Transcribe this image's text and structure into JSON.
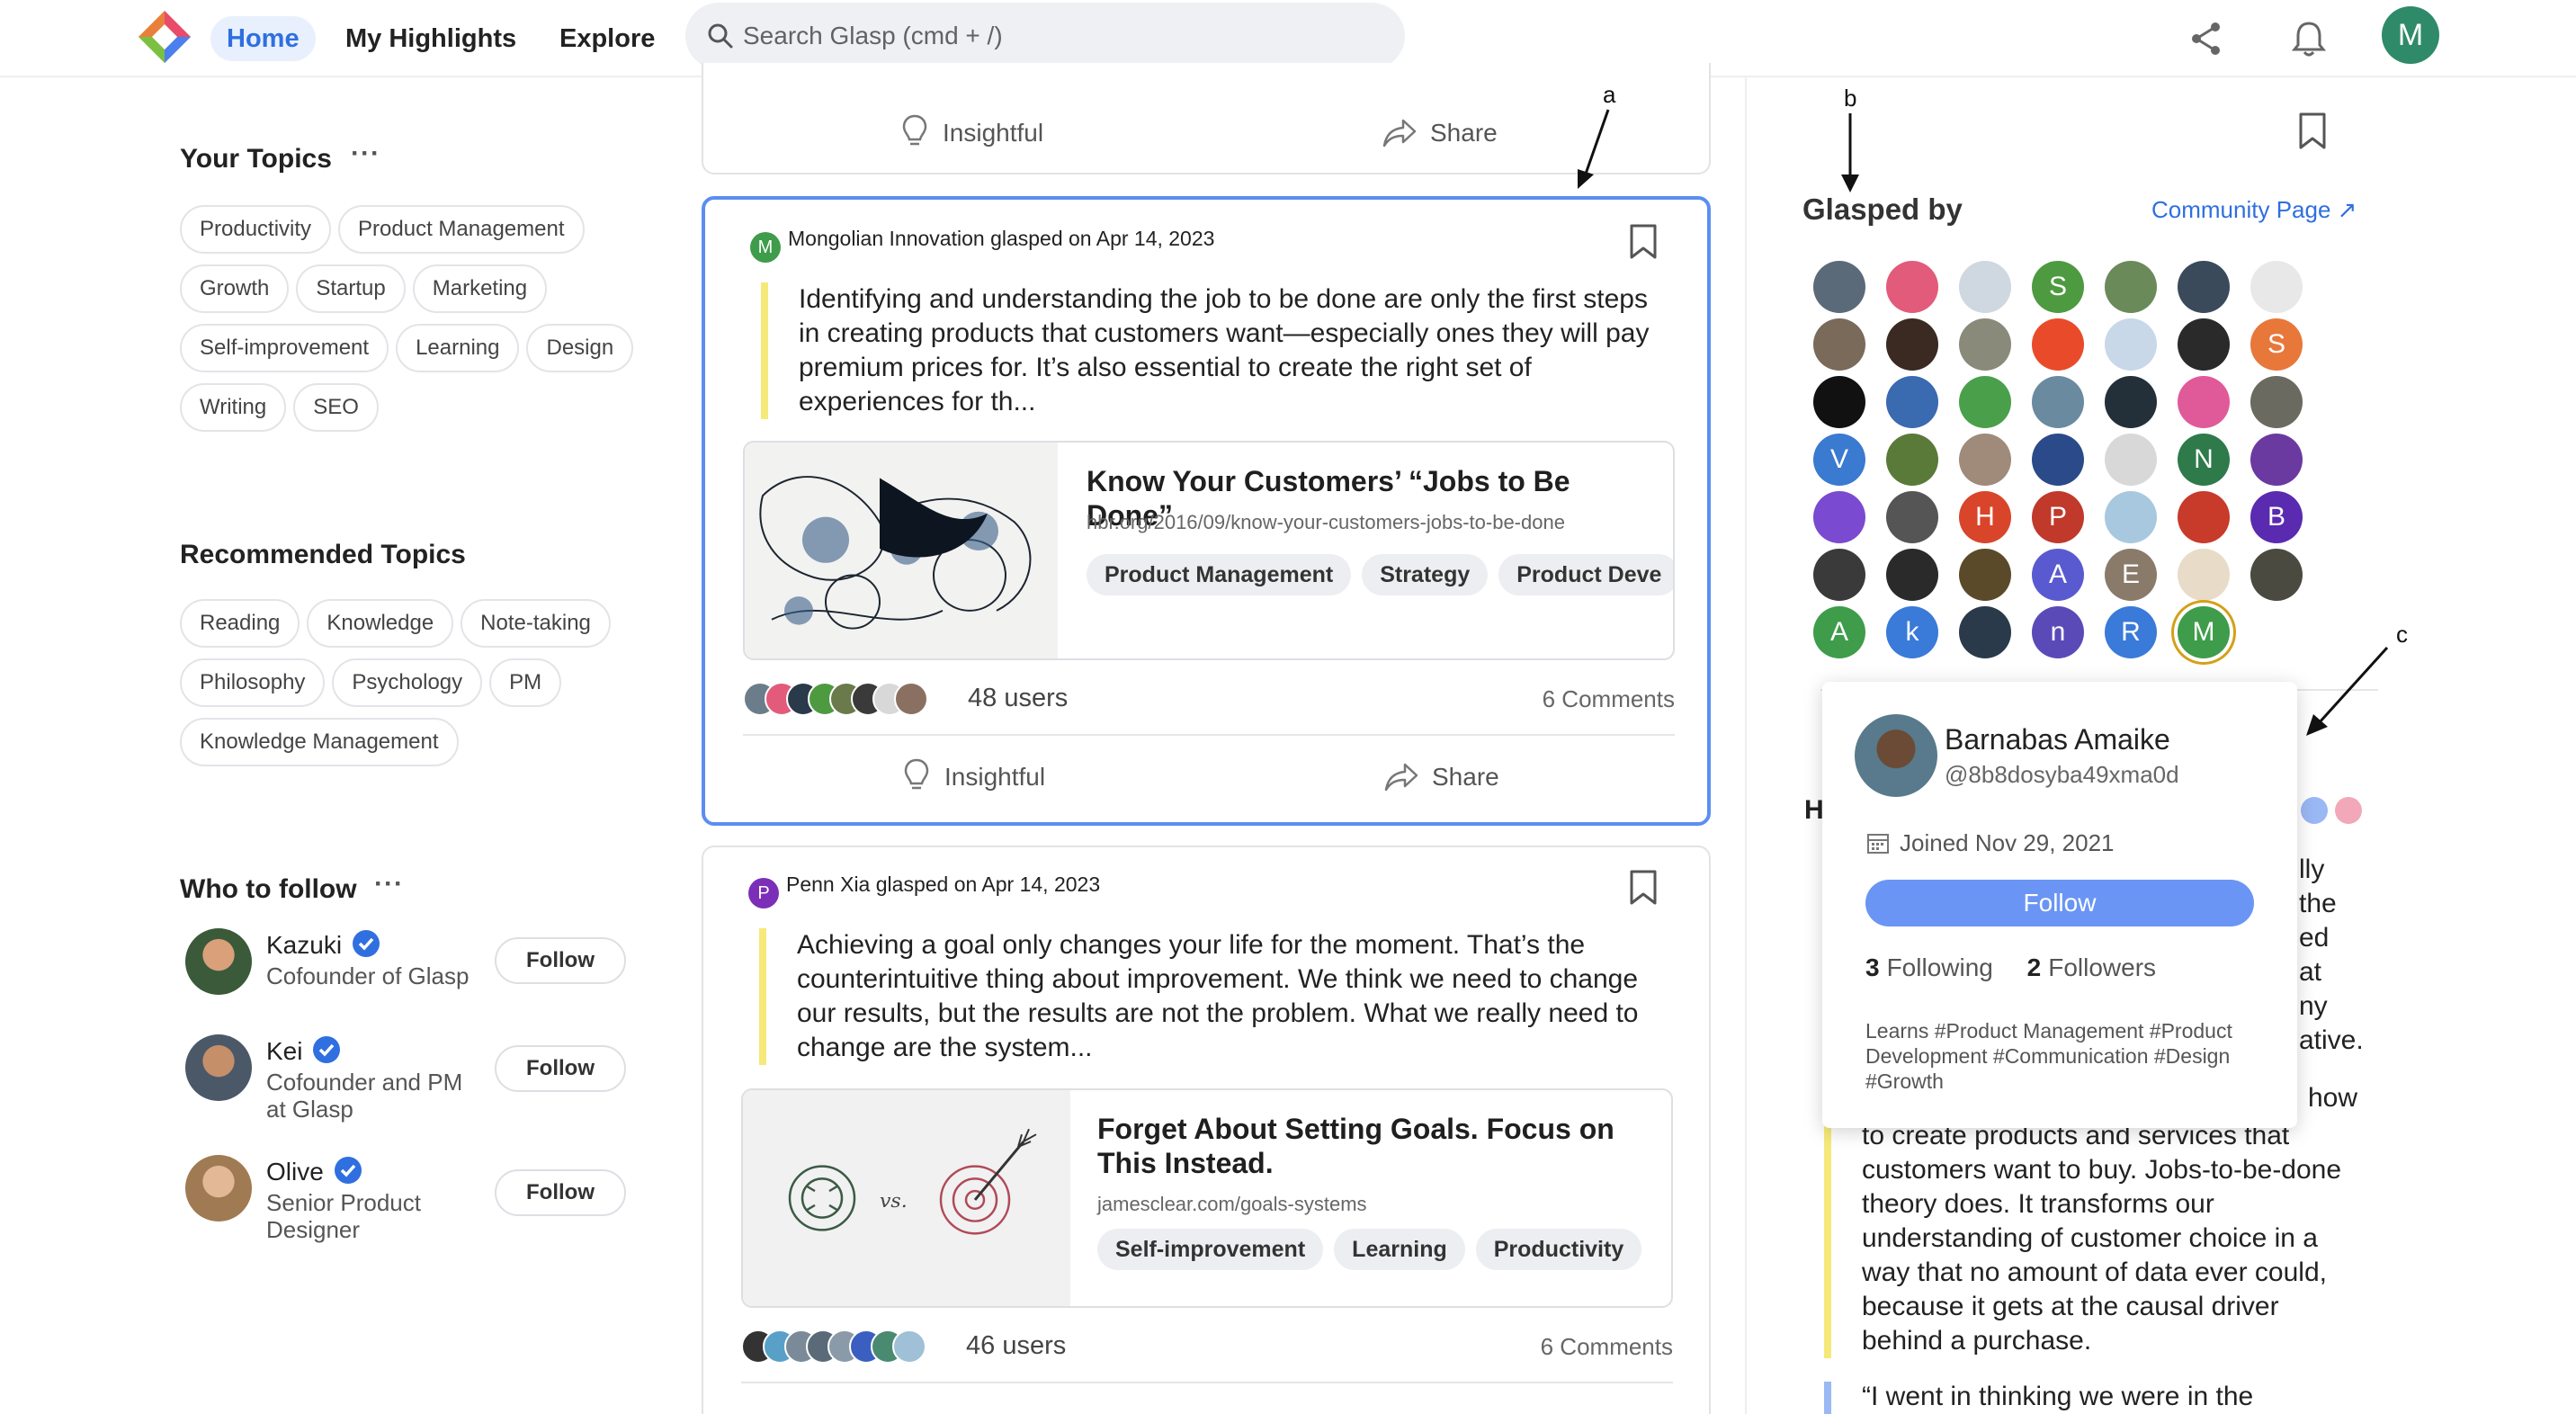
{
  "header": {
    "nav": [
      "Home",
      "My Highlights",
      "Explore"
    ],
    "search_placeholder": "Search Glasp (cmd + /)",
    "avatar_letter": "M"
  },
  "left": {
    "your_topics_title": "Your Topics",
    "your_topics": [
      "Productivity",
      "Product Management",
      "Growth",
      "Startup",
      "Marketing",
      "Self-improvement",
      "Learning",
      "Design",
      "Writing",
      "SEO"
    ],
    "recommended_title": "Recommended Topics",
    "recommended_topics": [
      "Reading",
      "Knowledge",
      "Note-taking",
      "Philosophy",
      "Psychology",
      "PM",
      "Knowledge Management"
    ],
    "who_to_follow_title": "Who to follow",
    "follow_label": "Follow",
    "people": [
      {
        "name": "Kazuki",
        "desc": "Cofounder of Glasp"
      },
      {
        "name": "Kei",
        "desc": "Cofounder and PM at Glasp"
      },
      {
        "name": "Olive",
        "desc": "Senior Product Designer"
      }
    ]
  },
  "feed": {
    "insightful_label": "Insightful",
    "share_label": "Share",
    "posts": [
      {
        "poster": "Mongolian Innovation",
        "poster_initial": "M",
        "poster_color": "#3e9c4a",
        "meta": "glasped on Apr 14, 2023",
        "quote": "Identifying and understanding the job to be done are only the first steps in creating products that customers want—especially ones they will pay premium prices for. It’s also essential to create the right set of experiences for th...",
        "article_title": "Know Your Customers’ “Jobs to Be Done”",
        "article_url": "hbr.org/2016/09/know-your-customers-jobs-to-be-done",
        "tags": [
          "Product Management",
          "Strategy",
          "Product Deve"
        ],
        "users": "48 users",
        "comments": "6 Comments"
      },
      {
        "poster": "Penn Xia",
        "poster_initial": "P",
        "poster_color": "#7b2fb8",
        "meta": "glasped on Apr 14, 2023",
        "quote": "Achieving a goal only changes your life for the moment. That’s the counterintuitive thing about improvement. We think we need to change our results, but the results are not the problem. What we really need to change are the system...",
        "article_title": "Forget About Setting Goals. Focus on This Instead.",
        "article_url": "jamesclear.com/goals-systems",
        "thumb_text": "vs.",
        "tags": [
          "Self-improvement",
          "Learning",
          "Productivity"
        ],
        "users": "46 users",
        "comments": "6 Comments"
      }
    ]
  },
  "right": {
    "glasped_by_title": "Glasped by",
    "community_link": "Community Page ↗",
    "grid_letters": [
      "S",
      "S",
      "V",
      "N",
      "H",
      "P",
      "B",
      "A",
      "E",
      "A",
      "k",
      "n",
      "R",
      "M"
    ],
    "popover": {
      "name": "Barnabas Amaike",
      "handle": "@8b8dosyba49xma0d",
      "joined": "Joined Nov 29, 2021",
      "follow_label": "Follow",
      "following_count": "3",
      "following_label": "Following",
      "followers_count": "2",
      "followers_label": "Followers",
      "learns": "Learns #Product Management #Product Development #Communication #Design #Growth"
    },
    "partial_lines": [
      "lly",
      "the",
      "ed",
      "at",
      "ny",
      "ative."
    ],
    "partial_h": "H",
    "partial_how": "how",
    "side_text": "to create products and services that customers want to buy. Jobs-to-be-done theory does. It transforms our understanding of customer choice in a way that no amount of data ever could, because it gets at the causal driver behind a purchase.",
    "side_text_2": "“I went in thinking we were in the"
  },
  "annotations": {
    "a": "a",
    "b": "b",
    "c": "c"
  },
  "colors": {
    "accent": "#2f6fe0",
    "highlight": "#f6e97a",
    "active_border": "#5b8ef0",
    "follow_blue": "#6a95f4"
  }
}
